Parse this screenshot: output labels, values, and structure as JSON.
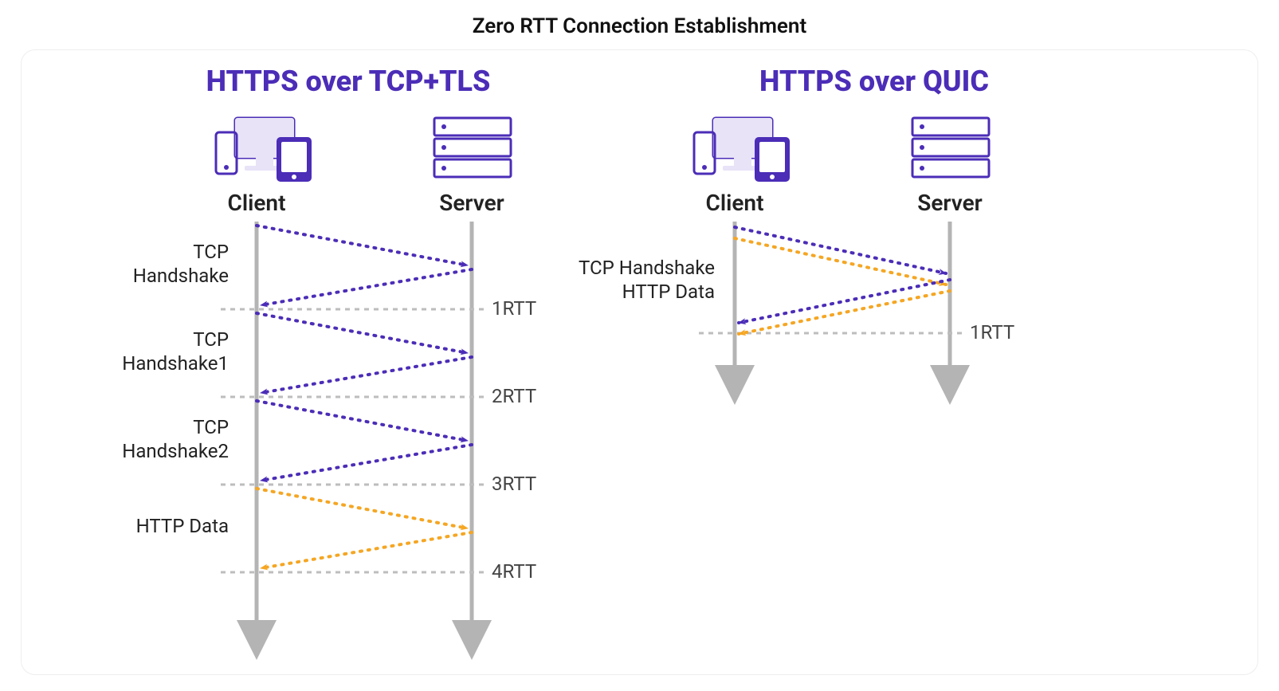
{
  "title": "Zero RTT Connection Establishment",
  "colors": {
    "purple": "#4b2db7",
    "orange": "#f5a623",
    "grey": "#b4b4b4"
  },
  "left": {
    "title": "HTTPS over TCP+TLS",
    "client_label": "Client",
    "server_label": "Server",
    "phases": [
      {
        "line1": "TCP",
        "line2": "Handshake"
      },
      {
        "line1": "TCP",
        "line2": "Handshake1"
      },
      {
        "line1": "TCP",
        "line2": "Handshake2"
      },
      {
        "line1": "HTTP Data",
        "line2": ""
      }
    ],
    "rtts": [
      "1RTT",
      "2RTT",
      "3RTT",
      "4RTT"
    ]
  },
  "right": {
    "title": "HTTPS over QUIC",
    "client_label": "Client",
    "server_label": "Server",
    "phase_line1": "TCP Handshake",
    "phase_line2": "HTTP Data",
    "rtts": [
      "1RTT"
    ]
  }
}
